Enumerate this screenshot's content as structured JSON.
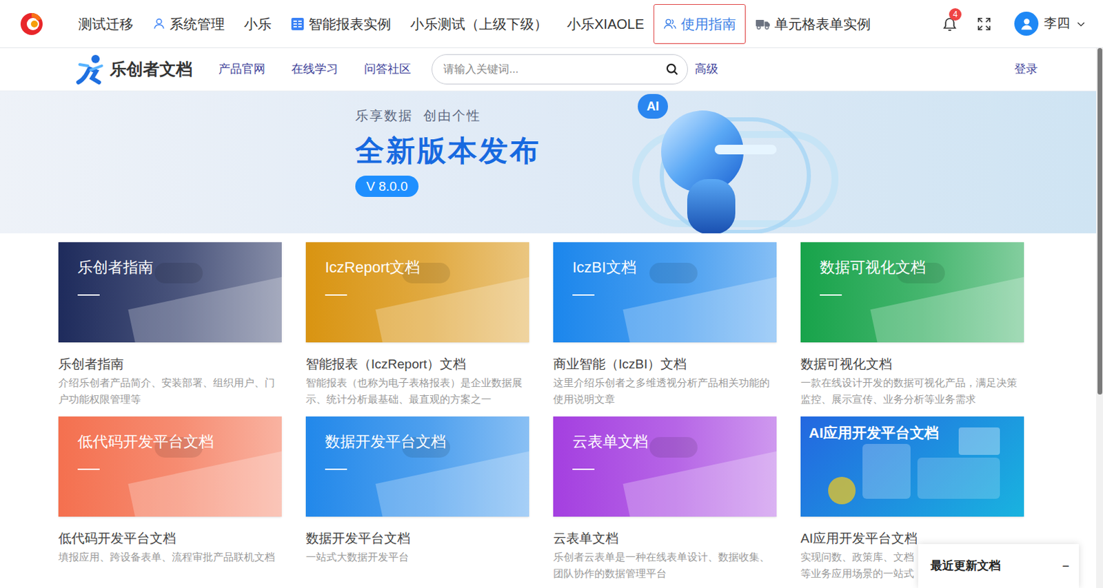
{
  "topnav": {
    "items": [
      {
        "label": "测试迁移",
        "selected": false,
        "kind": "plain"
      },
      {
        "label": "系统管理",
        "selected": false,
        "kind": "user"
      },
      {
        "label": "小乐",
        "selected": false,
        "kind": "plain"
      },
      {
        "label": "智能报表实例",
        "selected": false,
        "kind": "report"
      },
      {
        "label": "小乐测试（上级下级）",
        "selected": false,
        "kind": "plain"
      },
      {
        "label": "小乐XIAOLE",
        "selected": false,
        "kind": "plain"
      },
      {
        "label": "使用指南",
        "selected": true,
        "kind": "group"
      },
      {
        "label": "单元格表单实例",
        "selected": false,
        "kind": "truck"
      }
    ],
    "notifications": "4",
    "user": "李四"
  },
  "docnav": {
    "brand": "乐创者文档",
    "links": [
      "产品官网",
      "在线学习",
      "问答社区"
    ],
    "search": {
      "placeholder": "请输入关键词..."
    },
    "advanced": "高级",
    "login": "登录"
  },
  "banner": {
    "slogan": "乐享数据  创由个性",
    "headline": "全新版本发布",
    "version": "V 8.0.0",
    "badge": "AI"
  },
  "cards": [
    {
      "image_title": "乐创者指南",
      "title": "乐创者指南",
      "desc": "介绍乐创者产品简介、安装部署、组织用户、门户功能权限管理等",
      "color": "#1e2b5c",
      "kind": "photo"
    },
    {
      "image_title": "IczReport文档",
      "title": "智能报表（IczReport）文档",
      "desc": "智能报表（也称为电子表格报表）是企业数据展示、统计分析最基础、最直观的方案之一",
      "color": "#d99411",
      "kind": "photo"
    },
    {
      "image_title": "IczBI文档",
      "title": "商业智能（IczBI）文档",
      "desc": "这里介绍乐创者之多维透视分析产品相关功能的使用说明文章",
      "color": "#1b86ec",
      "kind": "photo"
    },
    {
      "image_title": "数据可视化文档",
      "title": "数据可视化文档",
      "desc": "一款在线设计开发的数据可视化产品，满足决策监控、展示宣传、业务分析等业务需求",
      "color": "#17a34a",
      "kind": "photo"
    },
    {
      "image_title": "低代码开发平台文档",
      "title": "低代码开发平台文档",
      "desc": "填报应用、跨设备表单、流程审批产品联机文档",
      "color": "#f4704f",
      "kind": "photo"
    },
    {
      "image_title": "数据开发平台文档",
      "title": "数据开发平台文档",
      "desc": "一站式大数据开发平台",
      "color": "#2288ea",
      "kind": "photo"
    },
    {
      "image_title": "云表单文档",
      "title": "云表单文档",
      "desc": "乐创者云表单是一种在线表单设计、数据收集、团队协作的数据管理平台",
      "color": "#a43fe0",
      "kind": "photo"
    },
    {
      "image_title": "AI应用开发平台文档",
      "title": "AI应用开发平台文档",
      "desc": "实现问数、政策库、文档等业务应用场景的一站式",
      "color": "#19b3df",
      "kind": "illustration"
    }
  ],
  "recent_panel": {
    "title": "最近更新文档",
    "toggle": "−"
  }
}
